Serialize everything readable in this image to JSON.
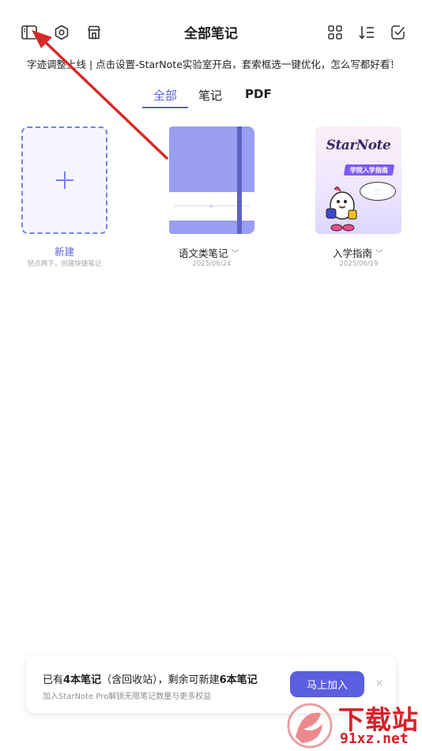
{
  "header": {
    "title": "全部笔记",
    "left_icons": [
      "sidebar-icon",
      "settings-hexagon-icon",
      "store-icon"
    ],
    "right_icons": [
      "grid-view-icon",
      "sort-icon",
      "select-check-icon"
    ]
  },
  "notice": {
    "text": "字迹调整上线 | 点击设置-StarNote实验室开启，套索框选一键优化，怎么写都好看！",
    "close": "×"
  },
  "tabs": [
    {
      "label": "全部",
      "active": true
    },
    {
      "label": "笔记",
      "active": false
    },
    {
      "label": "PDF",
      "active": false
    }
  ],
  "new_note": {
    "label": "新建",
    "hint": "轻点两下，创建快捷笔记"
  },
  "notebooks": [
    {
      "name": "语文类笔记",
      "date": "2025/06/24",
      "cover_color": "#9a9ef2"
    },
    {
      "name": "入学指南",
      "date": "2025/06/19",
      "cover_logo": "StarNote",
      "cover_badge": "学院入学指南"
    }
  ],
  "banner": {
    "text_prefix": "已有",
    "count_existing": "4本笔记",
    "text_middle": "（含回收站），剩余可新建",
    "count_remaining": "6本笔记",
    "subtext": "加入StarNote Pro解锁无限笔记数量与更多权益",
    "button": "马上加入",
    "close": "×"
  },
  "watermark": {
    "text": "下载站",
    "url": "91xz.net"
  },
  "colors": {
    "accent": "#5b5fe0",
    "annotation_arrow": "#d62a2a",
    "watermark": "#d6212a"
  }
}
